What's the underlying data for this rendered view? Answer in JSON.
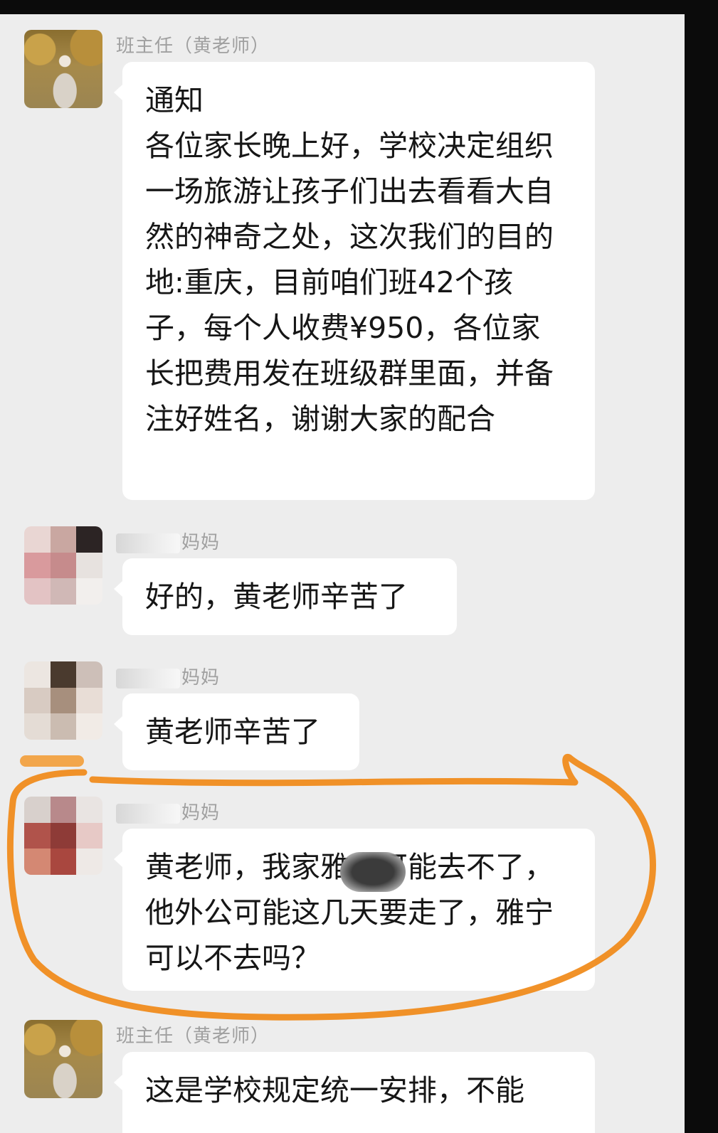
{
  "chat": {
    "messages": [
      {
        "sender": "班主任（黄老师）",
        "text": "通知\n各位家长晚上好，学校决定组织一场旅游让孩子们出去看看大自然的神奇之处，这次我们的目的地:重庆，目前咱们班42个孩子，每个人收费¥950，各位家长把费用发在班级群里面，并备注好姓名，谢谢大家的配合"
      },
      {
        "sender": "妈妈",
        "text": "好的，黄老师辛苦了"
      },
      {
        "sender": "妈妈",
        "text": "黄老师辛苦了"
      },
      {
        "sender": "妈妈",
        "text": "黄老师，我家雅宁可能去不了，他外公可能这几天要走了，雅宁可以不去吗？"
      },
      {
        "sender": "班主任（黄老师）",
        "text": "这是学校规定统一安排，不能"
      }
    ]
  },
  "colors": {
    "chat_background": "#ededed",
    "bubble": "#ffffff",
    "sender_name": "#a0a0a0",
    "message_text": "#161616",
    "highlight_stroke": "#f08c1e"
  }
}
